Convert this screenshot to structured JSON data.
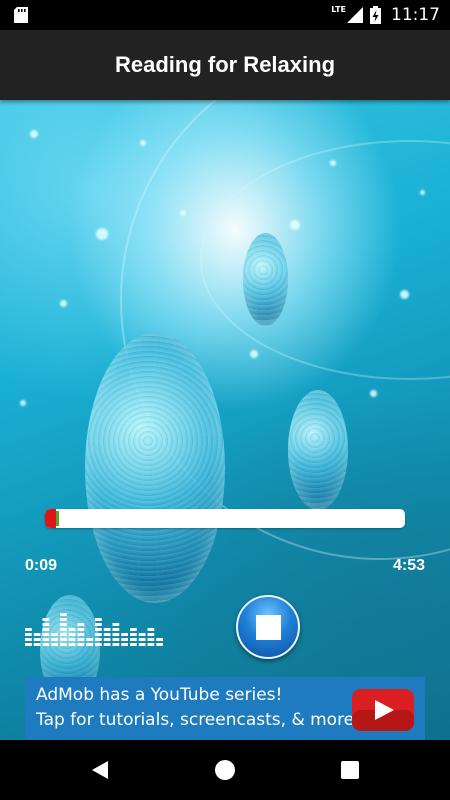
{
  "status_bar": {
    "time": "11:17",
    "network": "LTE",
    "icons": [
      "sd-card-icon",
      "signal-icon",
      "battery-charging-icon"
    ]
  },
  "app_bar": {
    "title": "Reading for Relaxing"
  },
  "player": {
    "elapsed": "0:09",
    "total": "4:53",
    "progress_fraction": 0.031,
    "buffered_color": "#d81818",
    "thumb_color": "#5aa130",
    "controls": [
      "equalizer-icon",
      "stop-icon"
    ],
    "equalizer_levels": [
      0.55,
      0.4,
      0.7,
      0.35,
      0.85,
      0.5,
      0.6,
      0.3,
      0.75,
      0.45,
      0.65,
      0.4,
      0.55,
      0.35,
      0.5,
      0.3
    ]
  },
  "ad": {
    "line1": "AdMob has a YouTube series!",
    "line2": "Tap for tutorials, screencasts, & more.",
    "icon": "youtube-play-icon",
    "background": "#1f7bbf"
  },
  "nav_bar": {
    "icons": [
      "back-icon",
      "home-icon",
      "recents-icon"
    ]
  }
}
